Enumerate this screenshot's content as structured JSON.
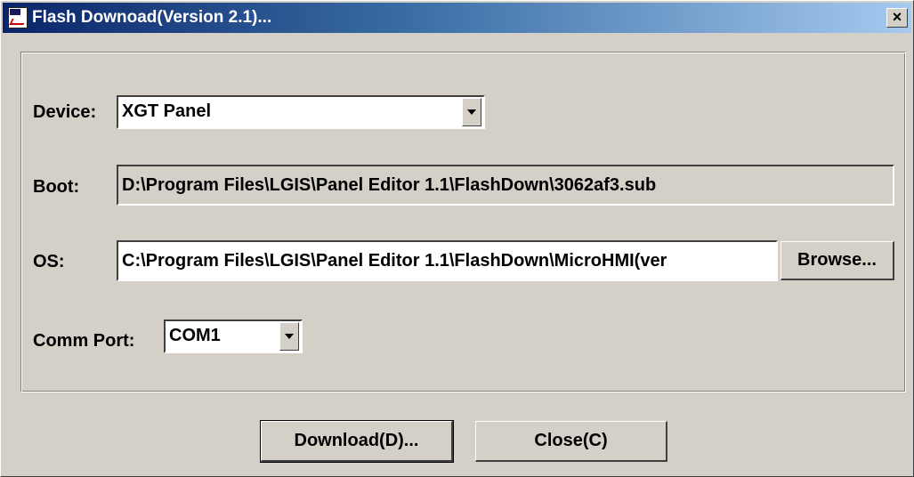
{
  "window": {
    "title": "Flash Downoad(Version 2.1)...",
    "close_glyph": "×"
  },
  "form": {
    "device_label": "Device:",
    "device_value": "XGT Panel",
    "boot_label": "Boot:",
    "boot_value": "D:\\Program Files\\LGIS\\Panel Editor 1.1\\FlashDown\\3062af3.sub",
    "os_label": "OS:",
    "os_value": "C:\\Program Files\\LGIS\\Panel Editor 1.1\\FlashDown\\MicroHMI(ver",
    "browse_label": "Browse...",
    "comm_label": "Comm Port:",
    "comm_value": "COM1"
  },
  "buttons": {
    "download_label": "Download(D)...",
    "close_label": "Close(C)"
  }
}
